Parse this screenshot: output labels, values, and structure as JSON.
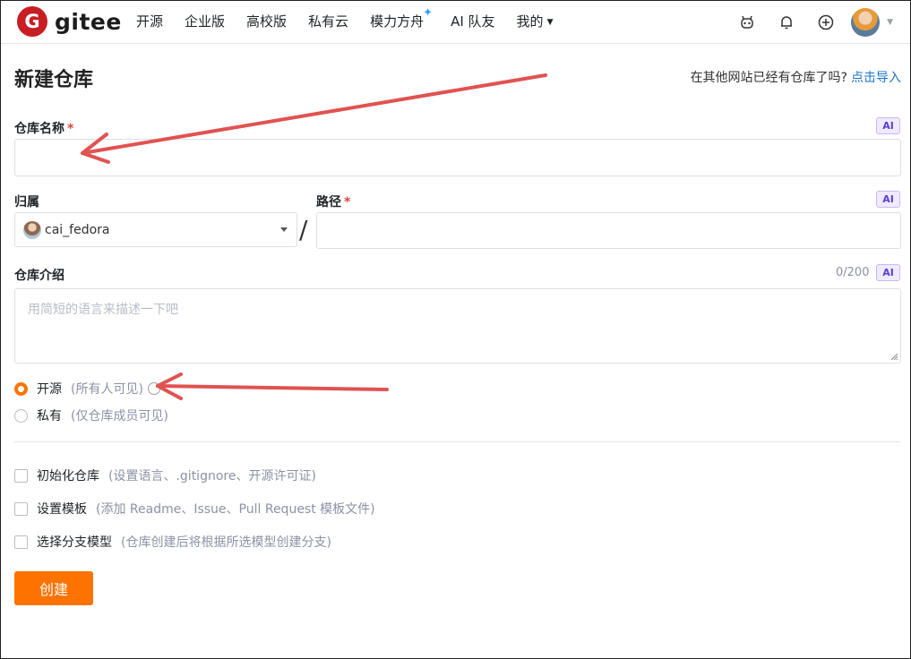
{
  "header": {
    "logo_letter": "G",
    "logo_text": "gitee",
    "nav": [
      "开源",
      "企业版",
      "高校版",
      "私有云",
      "模力方舟",
      "AI 队友",
      "我的"
    ],
    "sparkle_icon": "sparkle-icon",
    "icons": [
      "robot-icon",
      "bell-icon",
      "plus-circle-icon",
      "avatar",
      "chevron-down-icon"
    ]
  },
  "page": {
    "title": "新建仓库",
    "import_hint": "在其他网站已经有仓库了吗?",
    "import_link": "点击导入"
  },
  "form": {
    "name_label": "仓库名称",
    "required_mark": "*",
    "ai_badge": "AI",
    "owner_label": "归属",
    "owner_value": "cai_fedora",
    "path_separator": "/",
    "path_label": "路径",
    "desc_label": "仓库介绍",
    "desc_count": "0/200",
    "desc_placeholder": "用简短的语言来描述一下吧",
    "visibility": [
      {
        "label": "开源",
        "hint": "(所有人可见)",
        "checked": true
      },
      {
        "label": "私有",
        "hint": "(仅仓库成员可见)",
        "checked": false
      }
    ],
    "options": [
      {
        "label": "初始化仓库",
        "hint": "(设置语言、.gitignore、开源许可证)"
      },
      {
        "label": "设置模板",
        "hint": "(添加 Readme、Issue、Pull Request 模板文件)"
      },
      {
        "label": "选择分支模型",
        "hint": "(仓库创建后将根据所选模型创建分支)"
      }
    ],
    "submit": "创建"
  },
  "colors": {
    "brand_red": "#c71d23",
    "accent_orange": "#fe7300",
    "link_blue": "#1e73cc",
    "annotation_arrow": "#e05350"
  }
}
